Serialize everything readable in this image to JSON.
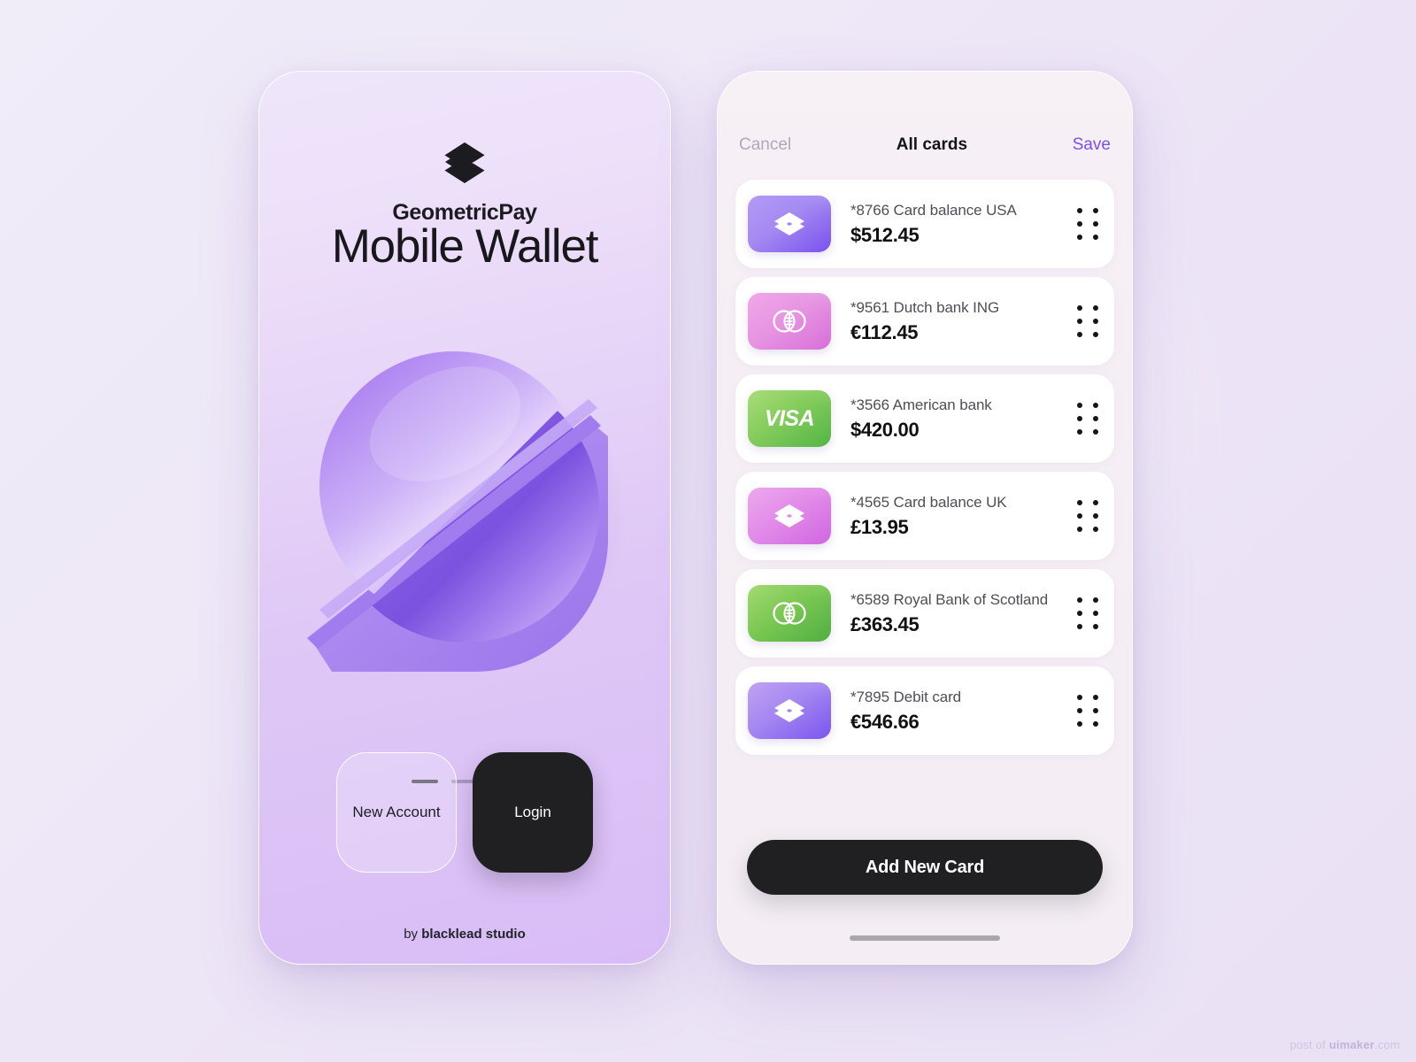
{
  "background": {
    "accent": "#7b4ff0",
    "dark": "#202022"
  },
  "left_screen": {
    "logo_icon": "geometric-pay-logo-icon",
    "brand_name": "GeometricPay",
    "hero_title": "Mobile Wallet",
    "illustration": "split-circle-3d-illustration",
    "pagination": {
      "total": 3,
      "active_index": 0
    },
    "buttons": {
      "new_account": "New Account",
      "login": "Login"
    },
    "footer": {
      "prefix": "by ",
      "studio": "blacklead studio"
    }
  },
  "right_screen": {
    "nav": {
      "cancel": "Cancel",
      "title": "All cards",
      "save": "Save"
    },
    "cards": [
      {
        "icon": "geometric-logo-icon",
        "theme": "th-violet",
        "label": "*8766 Card balance USA",
        "amount": "$512.45"
      },
      {
        "icon": "two-circles-icon",
        "theme": "th-pink",
        "label": "*9561 Dutch bank ING",
        "amount": "€112.45"
      },
      {
        "icon": "visa-wordmark-icon",
        "theme": "th-green",
        "label": "*3566 American bank",
        "amount": "$420.00"
      },
      {
        "icon": "geometric-logo-icon",
        "theme": "th-lilac",
        "label": "*4565 Card balance UK",
        "amount": "£13.95"
      },
      {
        "icon": "two-circles-icon",
        "theme": "th-green2",
        "label": "*6589 Royal Bank of Scotland",
        "amount": "£363.45"
      },
      {
        "icon": "geometric-logo-icon",
        "theme": "th-violet2",
        "label": "*7895 Debit card",
        "amount": "€546.66"
      }
    ],
    "visa_text": "VISA",
    "add_card_button": "Add New Card"
  },
  "watermark": {
    "prefix": "post of ",
    "site": "uimaker",
    "suffix": ".com"
  }
}
